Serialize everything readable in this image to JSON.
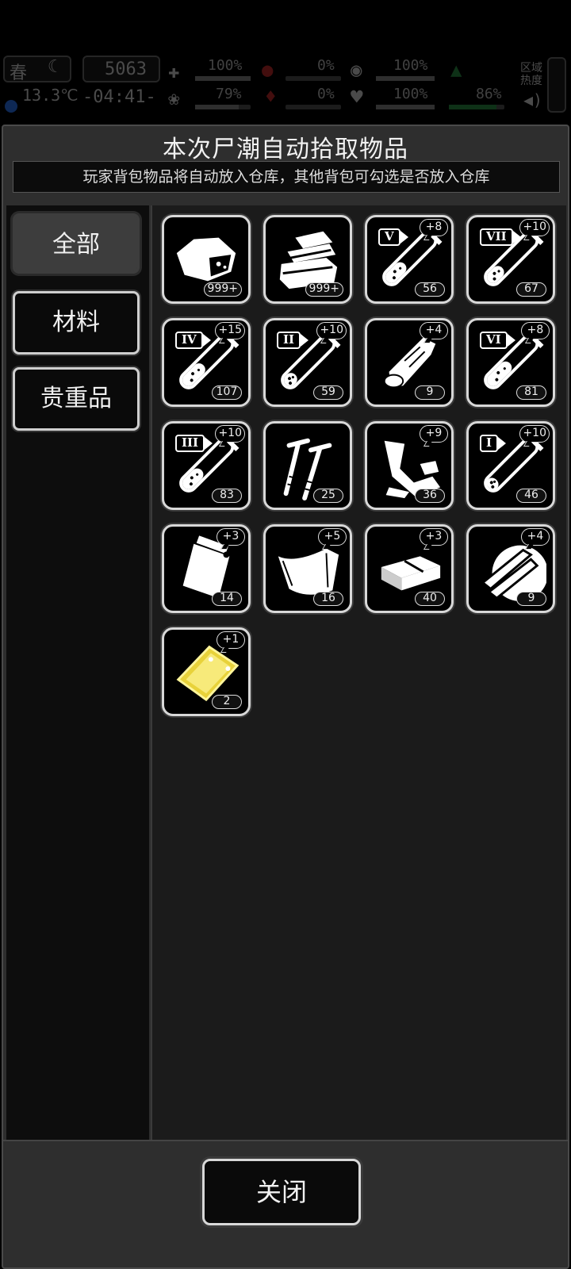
{
  "hud": {
    "season": "春",
    "temperature": "13.3℃",
    "day_counter": "5063",
    "time": "-04:41-",
    "area_label": "区域热度",
    "stats": [
      {
        "name": "health",
        "value": "100%",
        "arrow": "up"
      },
      {
        "name": "hunger",
        "value": "0%",
        "arrow": ""
      },
      {
        "name": "armor",
        "value": "100%",
        "arrow": "up"
      },
      {
        "name": "brain",
        "value": "79%",
        "arrow": "down"
      },
      {
        "name": "blood",
        "value": "0%",
        "arrow": "down"
      },
      {
        "name": "heart",
        "value": "100%",
        "arrow": "up"
      },
      {
        "name": "stamina",
        "value": "86%",
        "arrow": "down"
      }
    ]
  },
  "panel": {
    "title": "本次尸潮自动拾取物品",
    "subtitle": "玩家背包物品将自动放入仓库，其他背包可勾选是否放入仓库"
  },
  "tabs": [
    {
      "label": "全部",
      "active": true
    },
    {
      "label": "材料",
      "active": false
    },
    {
      "label": "贵重品",
      "active": false
    }
  ],
  "items": [
    {
      "icon": "meat-chunk-icon",
      "count": "999+",
      "bonus": "",
      "roman": ""
    },
    {
      "icon": "cloth-stack-icon",
      "count": "999+",
      "bonus": "",
      "roman": ""
    },
    {
      "icon": "test-tube-icon",
      "count": "56",
      "bonus": "+8",
      "roman": "V",
      "fill": 0.45
    },
    {
      "icon": "test-tube-icon",
      "count": "67",
      "bonus": "+10",
      "roman": "VII",
      "fill": 0.35
    },
    {
      "icon": "test-tube-icon",
      "count": "107",
      "bonus": "+15",
      "roman": "IV",
      "fill": 0.5
    },
    {
      "icon": "test-tube-icon",
      "count": "59",
      "bonus": "+10",
      "roman": "II",
      "fill": 0.25
    },
    {
      "icon": "wood-log-icon",
      "count": "9",
      "bonus": "+4",
      "roman": ""
    },
    {
      "icon": "test-tube-icon",
      "count": "81",
      "bonus": "+8",
      "roman": "VI",
      "fill": 0.55
    },
    {
      "icon": "test-tube-icon",
      "count": "83",
      "bonus": "+10",
      "roman": "III",
      "fill": 0.45
    },
    {
      "icon": "nails-icon",
      "count": "25",
      "bonus": "",
      "roman": ""
    },
    {
      "icon": "scrap-metal-icon",
      "count": "36",
      "bonus": "+9",
      "roman": ""
    },
    {
      "icon": "test-tube-icon",
      "count": "46",
      "bonus": "+10",
      "roman": "I",
      "fill": 0.2
    },
    {
      "icon": "plastic-bag-icon",
      "count": "14",
      "bonus": "+3",
      "roman": ""
    },
    {
      "icon": "leather-sheet-icon",
      "count": "16",
      "bonus": "+5",
      "roman": ""
    },
    {
      "icon": "brick-block-icon",
      "count": "40",
      "bonus": "+3",
      "roman": ""
    },
    {
      "icon": "wood-planks-icon",
      "count": "9",
      "bonus": "+4",
      "roman": ""
    },
    {
      "icon": "gold-card-icon",
      "count": "2",
      "bonus": "+1",
      "roman": ""
    }
  ],
  "footer": {
    "close_label": "关闭"
  }
}
